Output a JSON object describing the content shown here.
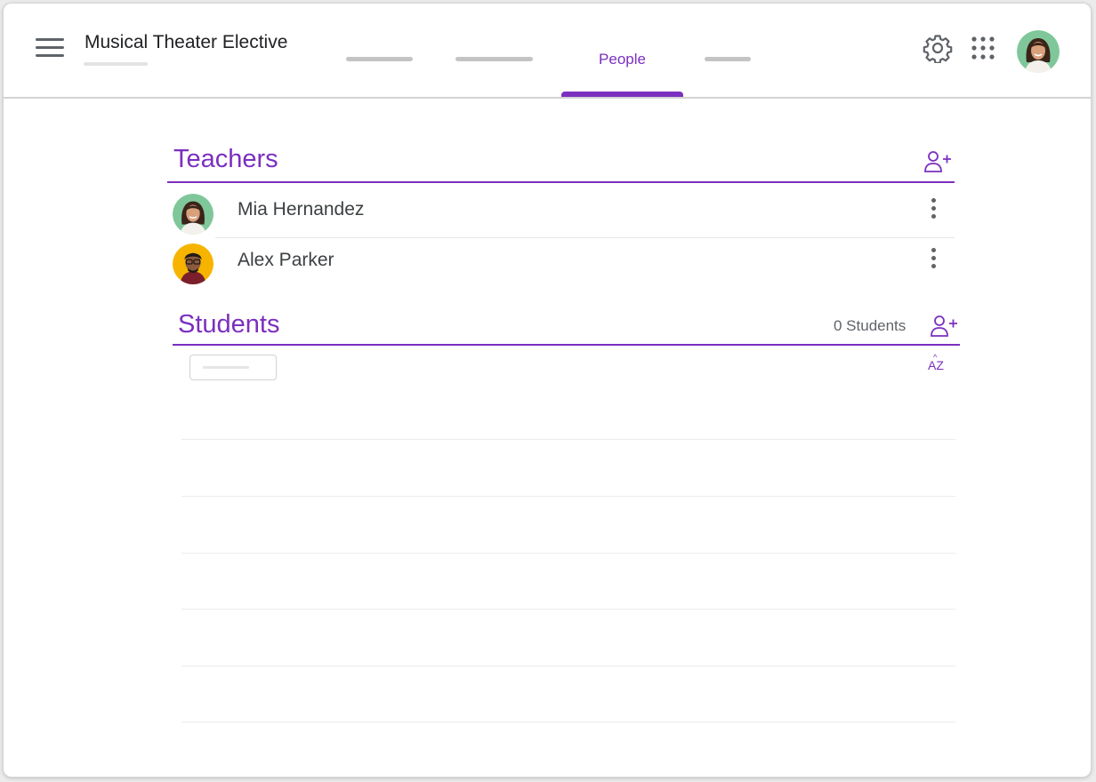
{
  "header": {
    "class_title": "Musical Theater Elective",
    "active_tab_label": "People"
  },
  "teachers": {
    "title": "Teachers",
    "list": [
      {
        "name": "Mia Hernandez"
      },
      {
        "name": "Alex Parker"
      }
    ]
  },
  "students": {
    "title": "Students",
    "count_label": "0 Students",
    "sort_label": "AZ"
  },
  "icons": {
    "menu": "hamburger-menu-icon",
    "settings": "gear-icon",
    "apps": "grid-apps-icon",
    "invite": "person-add-icon",
    "more": "kebab-more-icon",
    "sort": "sort-az-icon"
  },
  "colors": {
    "accent": "#7b2fbf",
    "text": "#3c4043",
    "icon": "#5f6368",
    "avatar_green": "#7fc79a",
    "avatar_yellow": "#f6b400"
  }
}
